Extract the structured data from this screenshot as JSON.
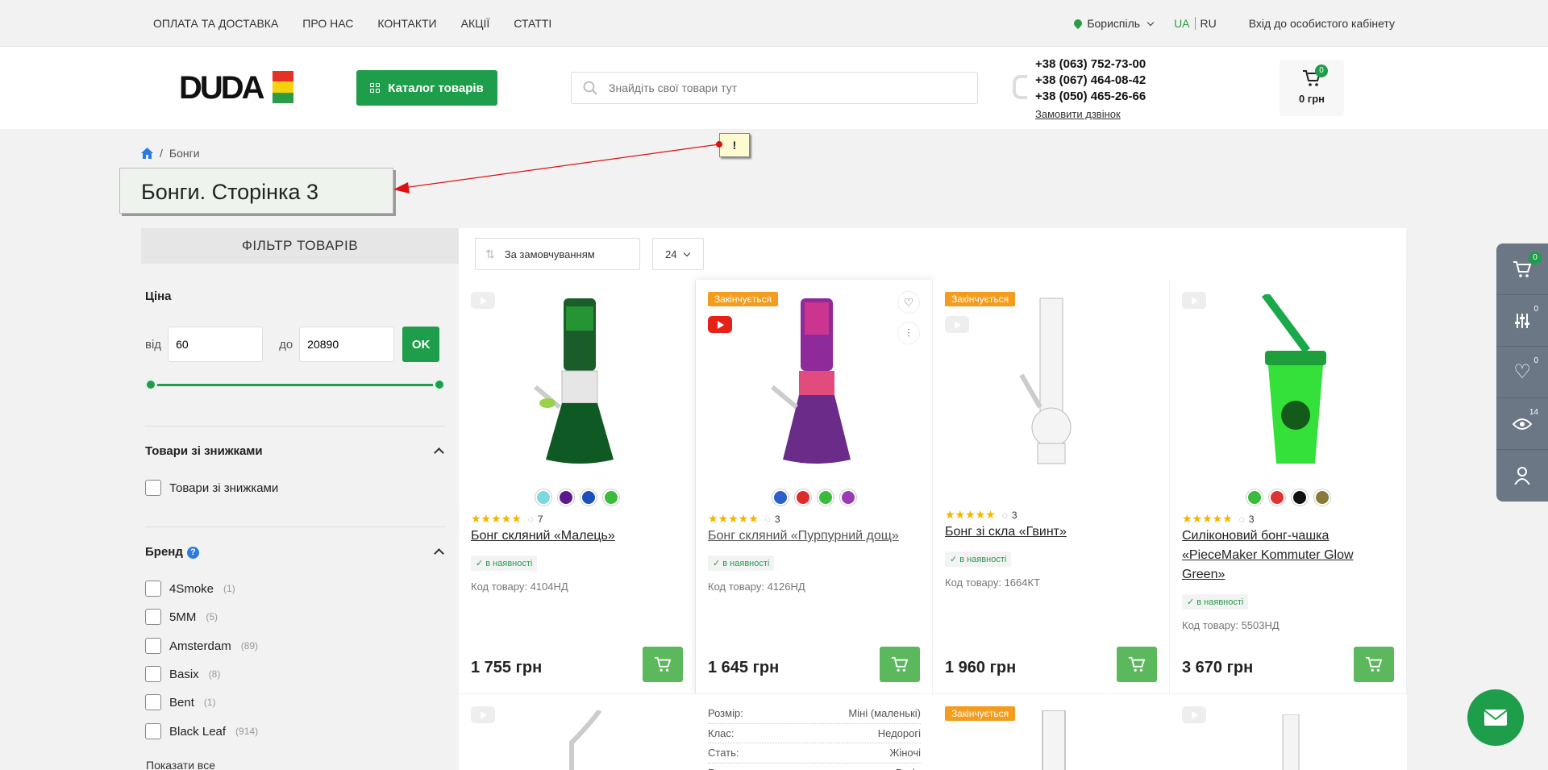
{
  "topnav": {
    "items": [
      "ОПЛАТА ТА ДОСТАВКА",
      "ПРО НАС",
      "КОНТАКТИ",
      "АКЦІЇ",
      "СТАТТІ"
    ],
    "city": "Бориспіль",
    "lang_ua": "UA",
    "lang_ru": "RU",
    "login": "Вхід до особистого кабінету"
  },
  "header": {
    "logo_text": "DUDA",
    "catalog_label": "Каталог товарів",
    "search_placeholder": "Знайдіть свої товари тут",
    "phones": [
      "+38 (063) 752-73-00",
      "+38 (067) 464-08-42",
      "+38 (050) 465-26-66"
    ],
    "callback": "Замовити дзвінок",
    "cart_count": "0",
    "cart_sum": "0 грн"
  },
  "breadcrumb": {
    "current": "Бонги",
    "sep": "/"
  },
  "page_title": "Бонги. Сторінка 3",
  "note": "!",
  "filter": {
    "heading": "ФІЛЬТР ТОВАРІВ",
    "price_title": "Ціна",
    "from_label": "від",
    "to_label": "до",
    "from_value": "60",
    "to_value": "20890",
    "ok": "OK",
    "discount_title": "Товари зі знижками",
    "discount_option": "Товари зі знижками",
    "brand_title": "Бренд",
    "brand_help": "?",
    "brands": [
      {
        "name": "4Smoke",
        "count": "(1)"
      },
      {
        "name": "5MM",
        "count": "(5)"
      },
      {
        "name": "Amsterdam",
        "count": "(89)"
      },
      {
        "name": "Basix",
        "count": "(8)"
      },
      {
        "name": "Bent",
        "count": "(1)"
      },
      {
        "name": "Black Leaf",
        "count": "(914)"
      }
    ],
    "show_all": "Показати все"
  },
  "toolbar": {
    "sort": "За замовчуванням",
    "per_page": "24"
  },
  "products": [
    {
      "tag": "",
      "stars": "★★★★★",
      "reviews": "7",
      "name": "Бонг скляний «Малець»",
      "stock": "✓ в наявності",
      "code_label": "Код товару:",
      "code": "4104НД",
      "price": "1 755 грн",
      "swatches": [
        "#7fd8dd",
        "#5a1a8e",
        "#1f4fb8",
        "#3bbb3b"
      ]
    },
    {
      "tag": "Закінчується",
      "stars": "★★★★★",
      "reviews": "3",
      "name": "Бонг скляний «Пурпурний дощ»",
      "stock": "✓ в наявності",
      "code_label": "Код товару:",
      "code": "4126НД",
      "price": "1 645 грн",
      "swatches": [
        "#2b5fc9",
        "#e02a2a",
        "#3bbb3b",
        "#9b3bb0"
      ]
    },
    {
      "tag": "Закінчується",
      "stars": "★★★★★",
      "reviews": "3",
      "name": "Бонг зі скла «Гвинт»",
      "stock": "✓ в наявності",
      "code_label": "Код товару:",
      "code": "1664КТ",
      "price": "1 960 грн",
      "swatches": []
    },
    {
      "tag": "",
      "stars": "★★★★★",
      "reviews": "3",
      "name": "Силіконовий бонг-чашка «PieceMaker Kommuter Glow Green»",
      "stock": "✓ в наявності",
      "code_label": "Код товару:",
      "code": "5503НД",
      "price": "3 670 грн",
      "swatches": [
        "#3bbb3b",
        "#d33",
        "#111",
        "#8a7a3a"
      ]
    }
  ],
  "row2": {
    "tag3": "Закінчується",
    "props": [
      {
        "k": "Розмір:",
        "v": "Міні (маленькі)"
      },
      {
        "k": "Клас:",
        "v": "Недорогі"
      },
      {
        "k": "Стать:",
        "v": "Жіночі"
      },
      {
        "k": "Бренд:",
        "v": "Duda"
      }
    ]
  },
  "right_panel": {
    "cart": "0",
    "compare": "0",
    "wishlist": "0",
    "viewed": "14"
  },
  "colors": {
    "accent": "#1e9e4a",
    "tag": "#f39c1d",
    "buy": "#5cb85c",
    "panel": "#6b7785"
  }
}
